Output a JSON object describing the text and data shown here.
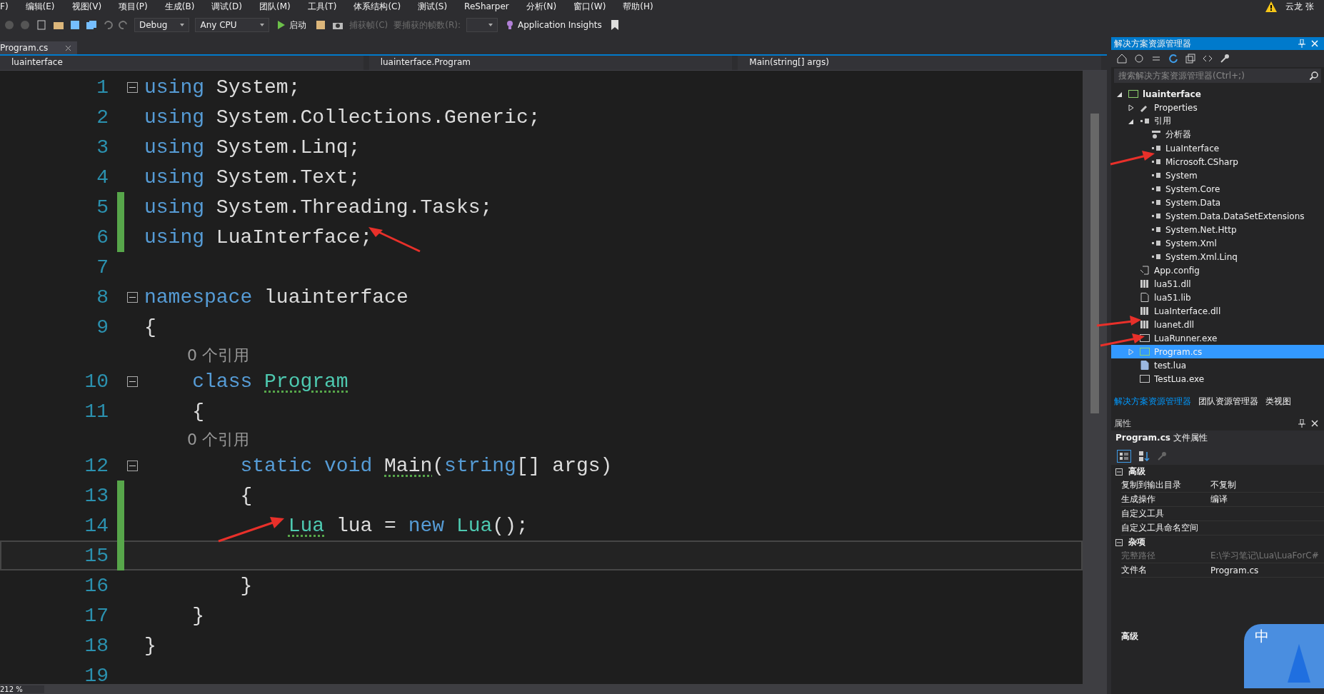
{
  "menu": [
    "F)",
    "编辑(E)",
    "视图(V)",
    "项目(P)",
    "生成(B)",
    "调试(D)",
    "团队(M)",
    "工具(T)",
    "体系结构(C)",
    "测试(S)",
    "ReSharper",
    "分析(N)",
    "窗口(W)",
    "帮助(H)"
  ],
  "user": {
    "name": "云龙 张"
  },
  "toolbar": {
    "configuration": "Debug",
    "platform": "Any CPU",
    "start": "启动",
    "capture": "捕获帧(C)",
    "frames_label": "要捕获的帧数(R):",
    "insights": "Application Insights"
  },
  "tabs": [
    {
      "label": "Program.cs",
      "selected": true
    }
  ],
  "nav": {
    "project": "luainterface",
    "type": "luainterface.Program",
    "member": "Main(string[] args)"
  },
  "code": [
    {
      "number": "1",
      "foldable": true,
      "changed": false,
      "current": false,
      "tokens": [
        {
          "text": "using",
          "kind": "keyword",
          "squiggle": false
        },
        {
          "text": " System;",
          "kind": "plain",
          "squiggle": false
        }
      ]
    },
    {
      "number": "2",
      "foldable": false,
      "changed": false,
      "current": false,
      "tokens": [
        {
          "text": "using",
          "kind": "keyword",
          "squiggle": false
        },
        {
          "text": " System.Collections.Generic;",
          "kind": "plain",
          "squiggle": false
        }
      ]
    },
    {
      "number": "3",
      "foldable": false,
      "changed": false,
      "current": false,
      "tokens": [
        {
          "text": "using",
          "kind": "keyword",
          "squiggle": false
        },
        {
          "text": " System.Linq;",
          "kind": "plain",
          "squiggle": false
        }
      ]
    },
    {
      "number": "4",
      "foldable": false,
      "changed": false,
      "current": false,
      "tokens": [
        {
          "text": "using",
          "kind": "keyword",
          "squiggle": false
        },
        {
          "text": " System.Text;",
          "kind": "plain",
          "squiggle": false
        }
      ]
    },
    {
      "number": "5",
      "foldable": false,
      "changed": true,
      "current": false,
      "tokens": [
        {
          "text": "using",
          "kind": "keyword",
          "squiggle": false
        },
        {
          "text": " System.Threading.Tasks;",
          "kind": "plain",
          "squiggle": false
        }
      ]
    },
    {
      "number": "6",
      "foldable": false,
      "changed": true,
      "current": false,
      "tokens": [
        {
          "text": "using",
          "kind": "keyword",
          "squiggle": false
        },
        {
          "text": " LuaInterface;",
          "kind": "plain",
          "squiggle": false
        }
      ]
    },
    {
      "number": "7",
      "foldable": false,
      "changed": false,
      "current": false
    },
    {
      "number": "8",
      "foldable": true,
      "changed": false,
      "current": false,
      "tokens": [
        {
          "text": "namespace",
          "kind": "keyword",
          "squiggle": false
        },
        {
          "text": " luainterface",
          "kind": "plain",
          "squiggle": false
        }
      ]
    },
    {
      "number": "9",
      "foldable": false,
      "changed": false,
      "current": false,
      "tokens": [
        {
          "text": "{",
          "kind": "plain",
          "squiggle": false
        }
      ]
    },
    {
      "number": "10",
      "foldable": true,
      "changed": false,
      "current": false,
      "codelens": "0 个引用",
      "tokens": [
        {
          "text": "    class ",
          "kind": "keyword",
          "squiggle": false
        },
        {
          "text": "Program",
          "kind": "type",
          "squiggle": true
        }
      ]
    },
    {
      "number": "11",
      "foldable": false,
      "changed": false,
      "current": false,
      "tokens": [
        {
          "text": "    {",
          "kind": "plain",
          "squiggle": false
        }
      ]
    },
    {
      "number": "12",
      "foldable": true,
      "changed": false,
      "current": false,
      "codelens": "0 个引用",
      "tokens": [
        {
          "text": "        static void ",
          "kind": "keyword",
          "squiggle": false
        },
        {
          "text": "Main",
          "kind": "plain",
          "squiggle": true
        },
        {
          "text": "(",
          "kind": "plain",
          "squiggle": false
        },
        {
          "text": "string",
          "kind": "keyword",
          "squiggle": false
        },
        {
          "text": "[] args)",
          "kind": "plain",
          "squiggle": false
        }
      ]
    },
    {
      "number": "13",
      "foldable": false,
      "changed": true,
      "current": false,
      "tokens": [
        {
          "text": "        {",
          "kind": "plain",
          "squiggle": false
        }
      ]
    },
    {
      "number": "14",
      "foldable": false,
      "changed": true,
      "current": false,
      "tokens": [
        {
          "text": "            Lua",
          "kind": "type",
          "squiggle": true
        },
        {
          "text": " lua = ",
          "kind": "plain",
          "squiggle": false
        },
        {
          "text": "new ",
          "kind": "keyword",
          "squiggle": false
        },
        {
          "text": "Lua",
          "kind": "type",
          "squiggle": false
        },
        {
          "text": "();",
          "kind": "plain",
          "squiggle": false
        }
      ]
    },
    {
      "number": "15",
      "foldable": false,
      "changed": true,
      "current": true
    },
    {
      "number": "16",
      "foldable": false,
      "changed": false,
      "current": false,
      "tokens": [
        {
          "text": "        }",
          "kind": "plain",
          "squiggle": false
        }
      ]
    },
    {
      "number": "17",
      "foldable": false,
      "changed": false,
      "current": false,
      "tokens": [
        {
          "text": "    }",
          "kind": "plain",
          "squiggle": false
        }
      ]
    },
    {
      "number": "18",
      "foldable": false,
      "changed": false,
      "current": false,
      "tokens": [
        {
          "text": "}",
          "kind": "plain",
          "squiggle": false
        }
      ]
    },
    {
      "number": "19",
      "foldable": false,
      "changed": false,
      "current": false
    }
  ],
  "zoom": "212 %",
  "solution_explorer": {
    "title": "解决方案资源管理器",
    "search_placeholder": "搜索解决方案资源管理器(Ctrl+;)",
    "tree": [
      {
        "label": "luainterface",
        "kind": "project",
        "expanded": true,
        "selected": false,
        "children": [
          {
            "label": "Properties",
            "kind": "properties",
            "expanded": false,
            "selected": false
          },
          {
            "label": "引用",
            "kind": "references",
            "expanded": true,
            "selected": false,
            "children": [
              {
                "label": "分析器",
                "kind": "analyzer",
                "selected": false
              },
              {
                "label": "LuaInterface",
                "kind": "reference",
                "selected": false
              },
              {
                "label": "Microsoft.CSharp",
                "kind": "reference",
                "selected": false
              },
              {
                "label": "System",
                "kind": "reference",
                "selected": false
              },
              {
                "label": "System.Core",
                "kind": "reference",
                "selected": false
              },
              {
                "label": "System.Data",
                "kind": "reference",
                "selected": false
              },
              {
                "label": "System.Data.DataSetExtensions",
                "kind": "reference",
                "selected": false
              },
              {
                "label": "System.Net.Http",
                "kind": "reference",
                "selected": false
              },
              {
                "label": "System.Xml",
                "kind": "reference",
                "selected": false
              },
              {
                "label": "System.Xml.Linq",
                "kind": "reference",
                "selected": false
              }
            ]
          },
          {
            "label": "App.config",
            "kind": "config",
            "selected": false
          },
          {
            "label": "lua51.dll",
            "kind": "dll",
            "selected": false
          },
          {
            "label": "lua51.lib",
            "kind": "file",
            "selected": false
          },
          {
            "label": "LuaInterface.dll",
            "kind": "dll",
            "selected": false
          },
          {
            "label": "luanet.dll",
            "kind": "dll",
            "selected": false
          },
          {
            "label": "LuaRunner.exe",
            "kind": "exe",
            "selected": false
          },
          {
            "label": "Program.cs",
            "kind": "csharp",
            "expanded": false,
            "selected": true
          },
          {
            "label": "test.lua",
            "kind": "lua",
            "selected": false
          },
          {
            "label": "TestLua.exe",
            "kind": "exe",
            "selected": false
          }
        ]
      }
    ],
    "tabs": [
      {
        "label": "解决方案资源管理器",
        "selected": true
      },
      {
        "label": "团队资源管理器",
        "selected": false
      },
      {
        "label": "类视图",
        "selected": false
      }
    ]
  },
  "properties": {
    "title": "属性",
    "object": "Program.cs",
    "object_type": "文件属性",
    "categories": [
      {
        "name": "高级",
        "expanded": true,
        "rows": [
          {
            "name": "复制到输出目录",
            "value": "不复制",
            "disabled": false
          },
          {
            "name": "生成操作",
            "value": "编译",
            "disabled": false
          },
          {
            "name": "自定义工具",
            "value": "",
            "disabled": false
          },
          {
            "name": "自定义工具命名空间",
            "value": "",
            "disabled": false
          }
        ]
      },
      {
        "name": "杂项",
        "expanded": true,
        "rows": [
          {
            "name": "完整路径",
            "value": "E:\\学习笔记\\Lua\\LuaForC#",
            "disabled": true
          },
          {
            "name": "文件名",
            "value": "Program.cs",
            "disabled": false
          }
        ]
      }
    ],
    "description": "高级"
  },
  "ime": {
    "label": "中"
  }
}
